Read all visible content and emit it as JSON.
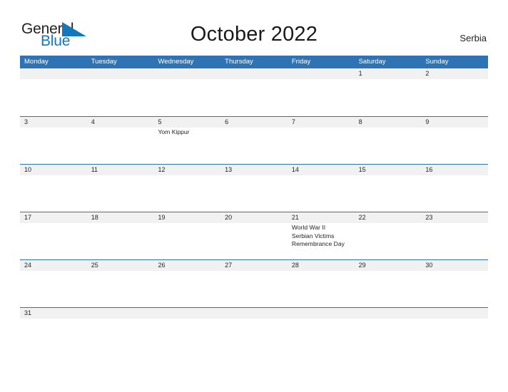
{
  "brand": {
    "word1": "General",
    "word2": "Blue",
    "flag_icon": "blue-triangle-flag-icon",
    "color_dark": "#231f20",
    "color_blue": "#1277bc"
  },
  "header": {
    "title": "October 2022",
    "region": "Serbia"
  },
  "theme": {
    "header_blue": "#2e73b4",
    "band_gray": "#f1f1f1",
    "text_dark": "#231f20",
    "page_background": "#ffffff"
  },
  "calendar": {
    "month": "October",
    "year": "2022",
    "weekday_headers": [
      "Monday",
      "Tuesday",
      "Wednesday",
      "Thursday",
      "Friday",
      "Saturday",
      "Sunday"
    ],
    "weeks": [
      {
        "days": [
          {
            "date": "",
            "events": ""
          },
          {
            "date": "",
            "events": ""
          },
          {
            "date": "",
            "events": ""
          },
          {
            "date": "",
            "events": ""
          },
          {
            "date": "",
            "events": ""
          },
          {
            "date": "1",
            "events": ""
          },
          {
            "date": "2",
            "events": ""
          }
        ]
      },
      {
        "days": [
          {
            "date": "3",
            "events": ""
          },
          {
            "date": "4",
            "events": ""
          },
          {
            "date": "5",
            "events": "Yom Kippur"
          },
          {
            "date": "6",
            "events": ""
          },
          {
            "date": "7",
            "events": ""
          },
          {
            "date": "8",
            "events": ""
          },
          {
            "date": "9",
            "events": ""
          }
        ]
      },
      {
        "days": [
          {
            "date": "10",
            "events": ""
          },
          {
            "date": "11",
            "events": ""
          },
          {
            "date": "12",
            "events": ""
          },
          {
            "date": "13",
            "events": ""
          },
          {
            "date": "14",
            "events": ""
          },
          {
            "date": "15",
            "events": ""
          },
          {
            "date": "16",
            "events": ""
          }
        ]
      },
      {
        "days": [
          {
            "date": "17",
            "events": ""
          },
          {
            "date": "18",
            "events": ""
          },
          {
            "date": "19",
            "events": ""
          },
          {
            "date": "20",
            "events": ""
          },
          {
            "date": "21",
            "events": "World War II\nSerbian Victims\nRemembrance Day"
          },
          {
            "date": "22",
            "events": ""
          },
          {
            "date": "23",
            "events": ""
          }
        ]
      },
      {
        "days": [
          {
            "date": "24",
            "events": ""
          },
          {
            "date": "25",
            "events": ""
          },
          {
            "date": "26",
            "events": ""
          },
          {
            "date": "27",
            "events": ""
          },
          {
            "date": "28",
            "events": ""
          },
          {
            "date": "29",
            "events": ""
          },
          {
            "date": "30",
            "events": ""
          }
        ]
      },
      {
        "days": [
          {
            "date": "31",
            "events": ""
          },
          {
            "date": "",
            "events": ""
          },
          {
            "date": "",
            "events": ""
          },
          {
            "date": "",
            "events": ""
          },
          {
            "date": "",
            "events": ""
          },
          {
            "date": "",
            "events": ""
          },
          {
            "date": "",
            "events": ""
          }
        ]
      }
    ]
  }
}
